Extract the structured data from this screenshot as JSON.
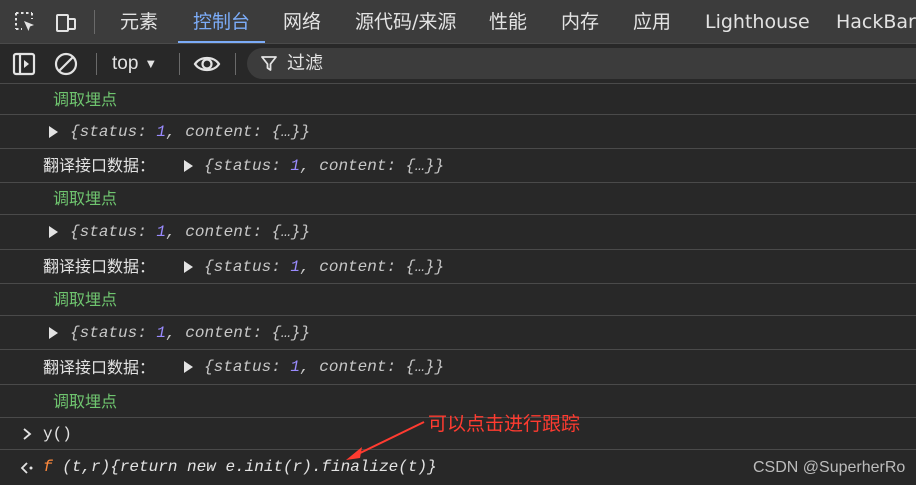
{
  "tabs": [
    {
      "label": "元素",
      "active": false
    },
    {
      "label": "控制台",
      "active": true
    },
    {
      "label": "网络",
      "active": false
    },
    {
      "label": "源代码/来源",
      "active": false
    },
    {
      "label": "性能",
      "active": false
    },
    {
      "label": "内存",
      "active": false
    },
    {
      "label": "应用",
      "active": false
    },
    {
      "label": "Lighthouse",
      "active": false
    },
    {
      "label": "HackBar",
      "active": false
    }
  ],
  "icons": {
    "inspect": "inspect-element-icon",
    "device": "device-toolbar-icon",
    "sidebar": "sidebar-toggle-icon",
    "clear": "clear-console-icon",
    "eye": "live-expression-icon",
    "filter": "filter-icon",
    "expand": "expand-triangle-icon",
    "input_prompt": "chevron-right-icon",
    "result_prompt": "return-value-icon"
  },
  "toolbar": {
    "context": "top",
    "context_caret": "▼",
    "filter_placeholder": "过滤"
  },
  "console": {
    "log_label": "调取埋点",
    "object_preview": {
      "open": "{",
      "k1": "status",
      "v1": "1",
      "k2": "content",
      "v2": "{…}",
      "close": "}"
    },
    "translate_label": "翻译接口数据：",
    "input_command": "y()",
    "result_prefix": "f",
    "result_text": "(t,r){return new e.init(r).finalize(t)}"
  },
  "annotation": {
    "text": "可以点击进行跟踪",
    "color": "#ff3b30"
  },
  "watermark": "CSDN @SuperherRo",
  "colors": {
    "active_tab": "#7cacf8",
    "log_green": "#6fc56f",
    "number_purple": "#9a8bff",
    "function_orange": "#ff8a3d",
    "background": "#282828",
    "tabbar": "#3c3c3c"
  }
}
